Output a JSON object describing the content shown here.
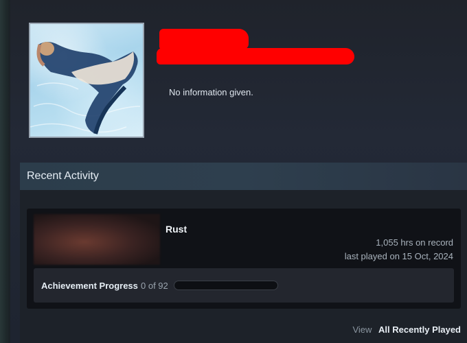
{
  "profile": {
    "avatar_icon": "mermaid-avatar",
    "summary": "No information given."
  },
  "recent_activity": {
    "header": "Recent Activity",
    "games": [
      {
        "name": "Rust",
        "hours": "1,055 hrs on record",
        "last_played": "last played on 15 Oct, 2024",
        "achievement_label": "Achievement Progress",
        "achievement_count": "0 of 92",
        "achievement_fraction": 0
      }
    ],
    "footer": {
      "view_label": "View",
      "link_label": "All Recently Played"
    }
  },
  "colors": {
    "redaction": "#ff0000",
    "header_bg": "#2c3d4b",
    "card_bg": "#101217"
  }
}
